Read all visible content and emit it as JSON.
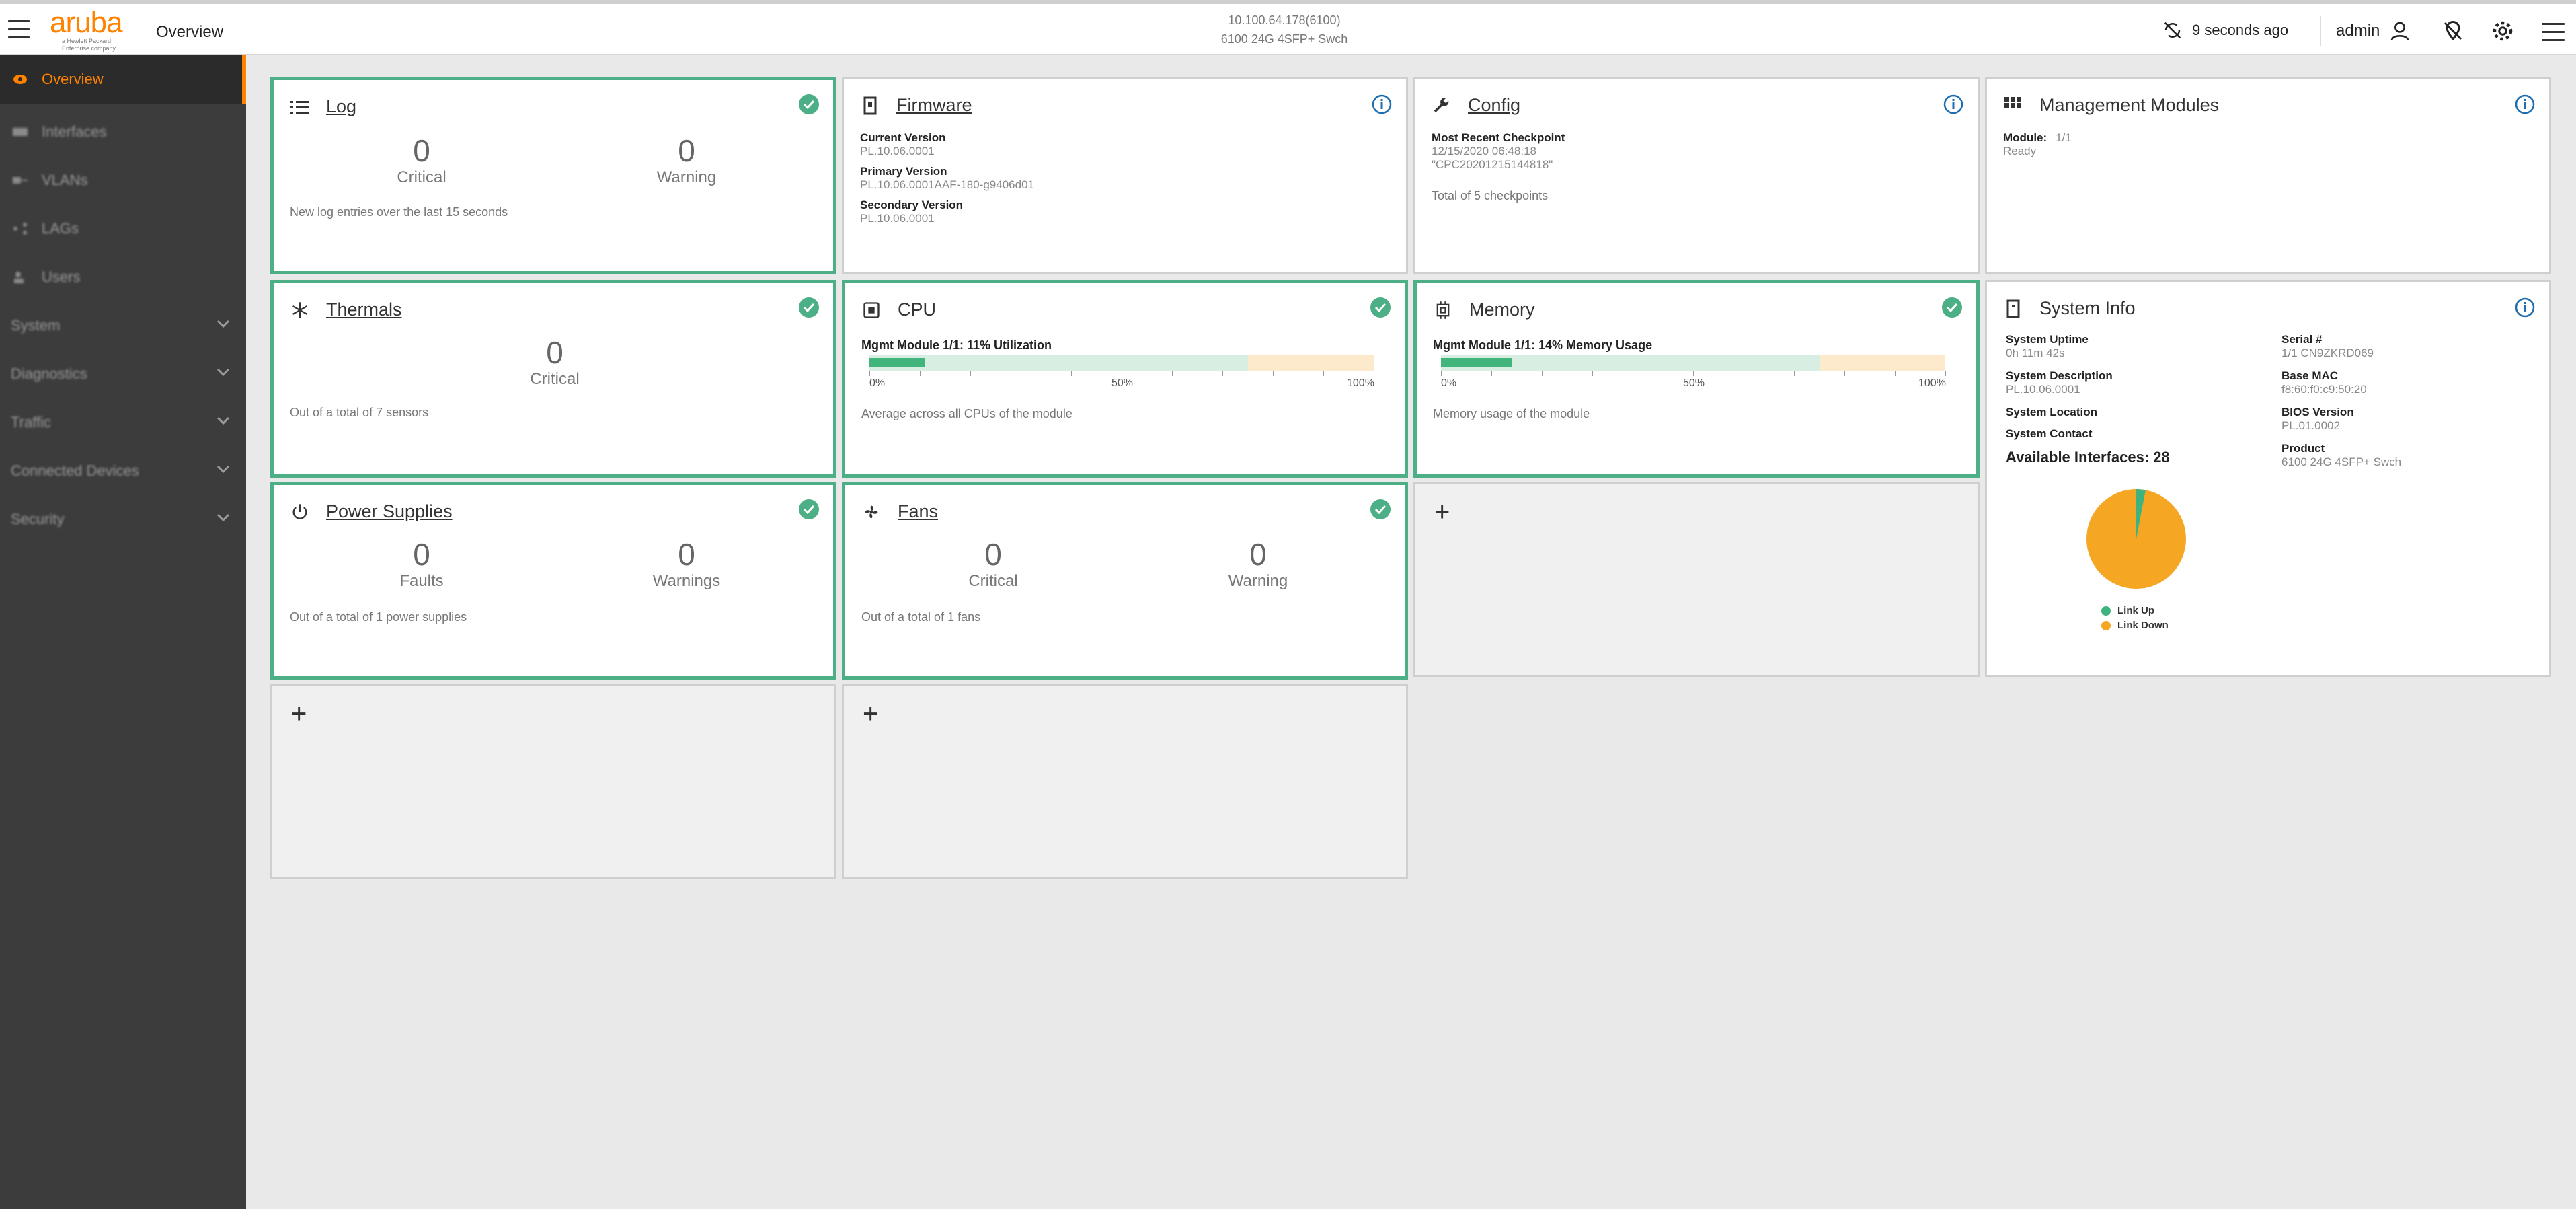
{
  "header": {
    "page_title": "Overview",
    "device_address": "10.100.64.178(6100)",
    "device_model": "6100 24G 4SFP+ Swch",
    "refresh_text": "9 seconds ago",
    "username": "admin"
  },
  "logo": {
    "word": "aruba",
    "tagline": "a Hewlett Packard Enterprise company"
  },
  "sidebar": {
    "items": [
      {
        "label": "Overview",
        "icon": "eye-icon",
        "active": true
      },
      {
        "label": "Interfaces",
        "icon": "interfaces-icon"
      },
      {
        "label": "VLANs",
        "icon": "vlans-icon"
      },
      {
        "label": "LAGs",
        "icon": "share-icon"
      },
      {
        "label": "Users",
        "icon": "users-icon"
      },
      {
        "label": "System",
        "icon": "chevron-down-icon"
      },
      {
        "label": "Diagnostics",
        "icon": "chevron-down-icon"
      },
      {
        "label": "Traffic",
        "icon": "chevron-down-icon"
      },
      {
        "label": "Connected Devices",
        "icon": "chevron-down-icon"
      },
      {
        "label": "Security",
        "icon": "chevron-down-icon"
      }
    ]
  },
  "colors": {
    "accent": "#ff8300",
    "ok": "#4caf85",
    "info": "#1f6fb0",
    "link_down": "#f5a623",
    "link_up": "#3fb37f"
  },
  "log": {
    "title": "Log",
    "critical_value": "0",
    "critical_label": "Critical",
    "warning_value": "0",
    "warning_label": "Warning",
    "footnote": "New log entries over the last 15 seconds"
  },
  "firmware": {
    "title": "Firmware",
    "current_label": "Current Version",
    "current_value": "PL.10.06.0001",
    "primary_label": "Primary Version",
    "primary_value": "PL.10.06.0001AAF-180-g9406d01",
    "secondary_label": "Secondary Version",
    "secondary_value": "PL.10.06.0001"
  },
  "config": {
    "title": "Config",
    "checkpoint_label": "Most Recent Checkpoint",
    "checkpoint_date": "12/15/2020 06:48:18",
    "checkpoint_name": "\"CPC20201215144818\"",
    "footnote": "Total of 5 checkpoints"
  },
  "mgmt": {
    "title": "Management Modules",
    "module_label": "Module:",
    "module_value": "1/1",
    "status": "Ready"
  },
  "thermals": {
    "title": "Thermals",
    "critical_value": "0",
    "critical_label": "Critical",
    "footnote": "Out of a total of 7 sensors"
  },
  "cpu": {
    "title": "CPU",
    "bar_label": "Mgmt Module 1/1: 11% Utilization",
    "utilization": 0.11,
    "tick_0": "0%",
    "tick_50": "50%",
    "tick_100": "100%",
    "footnote": "Average across all CPUs of the module"
  },
  "memory": {
    "title": "Memory",
    "bar_label": "Mgmt Module 1/1: 14% Memory Usage",
    "utilization": 0.14,
    "tick_0": "0%",
    "tick_50": "50%",
    "tick_100": "100%",
    "footnote": "Memory usage of the module"
  },
  "sysinfo": {
    "title": "System Info",
    "uptime_label": "System Uptime",
    "uptime_value": "0h 11m 42s",
    "serial_label": "Serial #",
    "serial_value": "1/1 CN9ZKRD069",
    "desc_label": "System Description",
    "desc_value": "PL.10.06.0001",
    "mac_label": "Base MAC",
    "mac_value": "f8:60:f0:c9:50:20",
    "location_label": "System Location",
    "bios_label": "BIOS Version",
    "bios_value": "PL.01.0002",
    "contact_label": "System Contact",
    "product_label": "Product",
    "product_value": "6100 24G 4SFP+ Swch",
    "available_label": "Available Interfaces: 28",
    "link_up_label": "Link Up",
    "link_down_label": "Link Down",
    "link_up_fraction": 0.03
  },
  "power": {
    "title": "Power Supplies",
    "faults_value": "0",
    "faults_label": "Faults",
    "warnings_value": "0",
    "warnings_label": "Warnings",
    "footnote": "Out of a total of 1 power supplies"
  },
  "fans": {
    "title": "Fans",
    "critical_value": "0",
    "critical_label": "Critical",
    "warning_value": "0",
    "warning_label": "Warning",
    "footnote": "Out of a total of 1 fans"
  },
  "empty_cards": {
    "add_symbol": "+"
  }
}
